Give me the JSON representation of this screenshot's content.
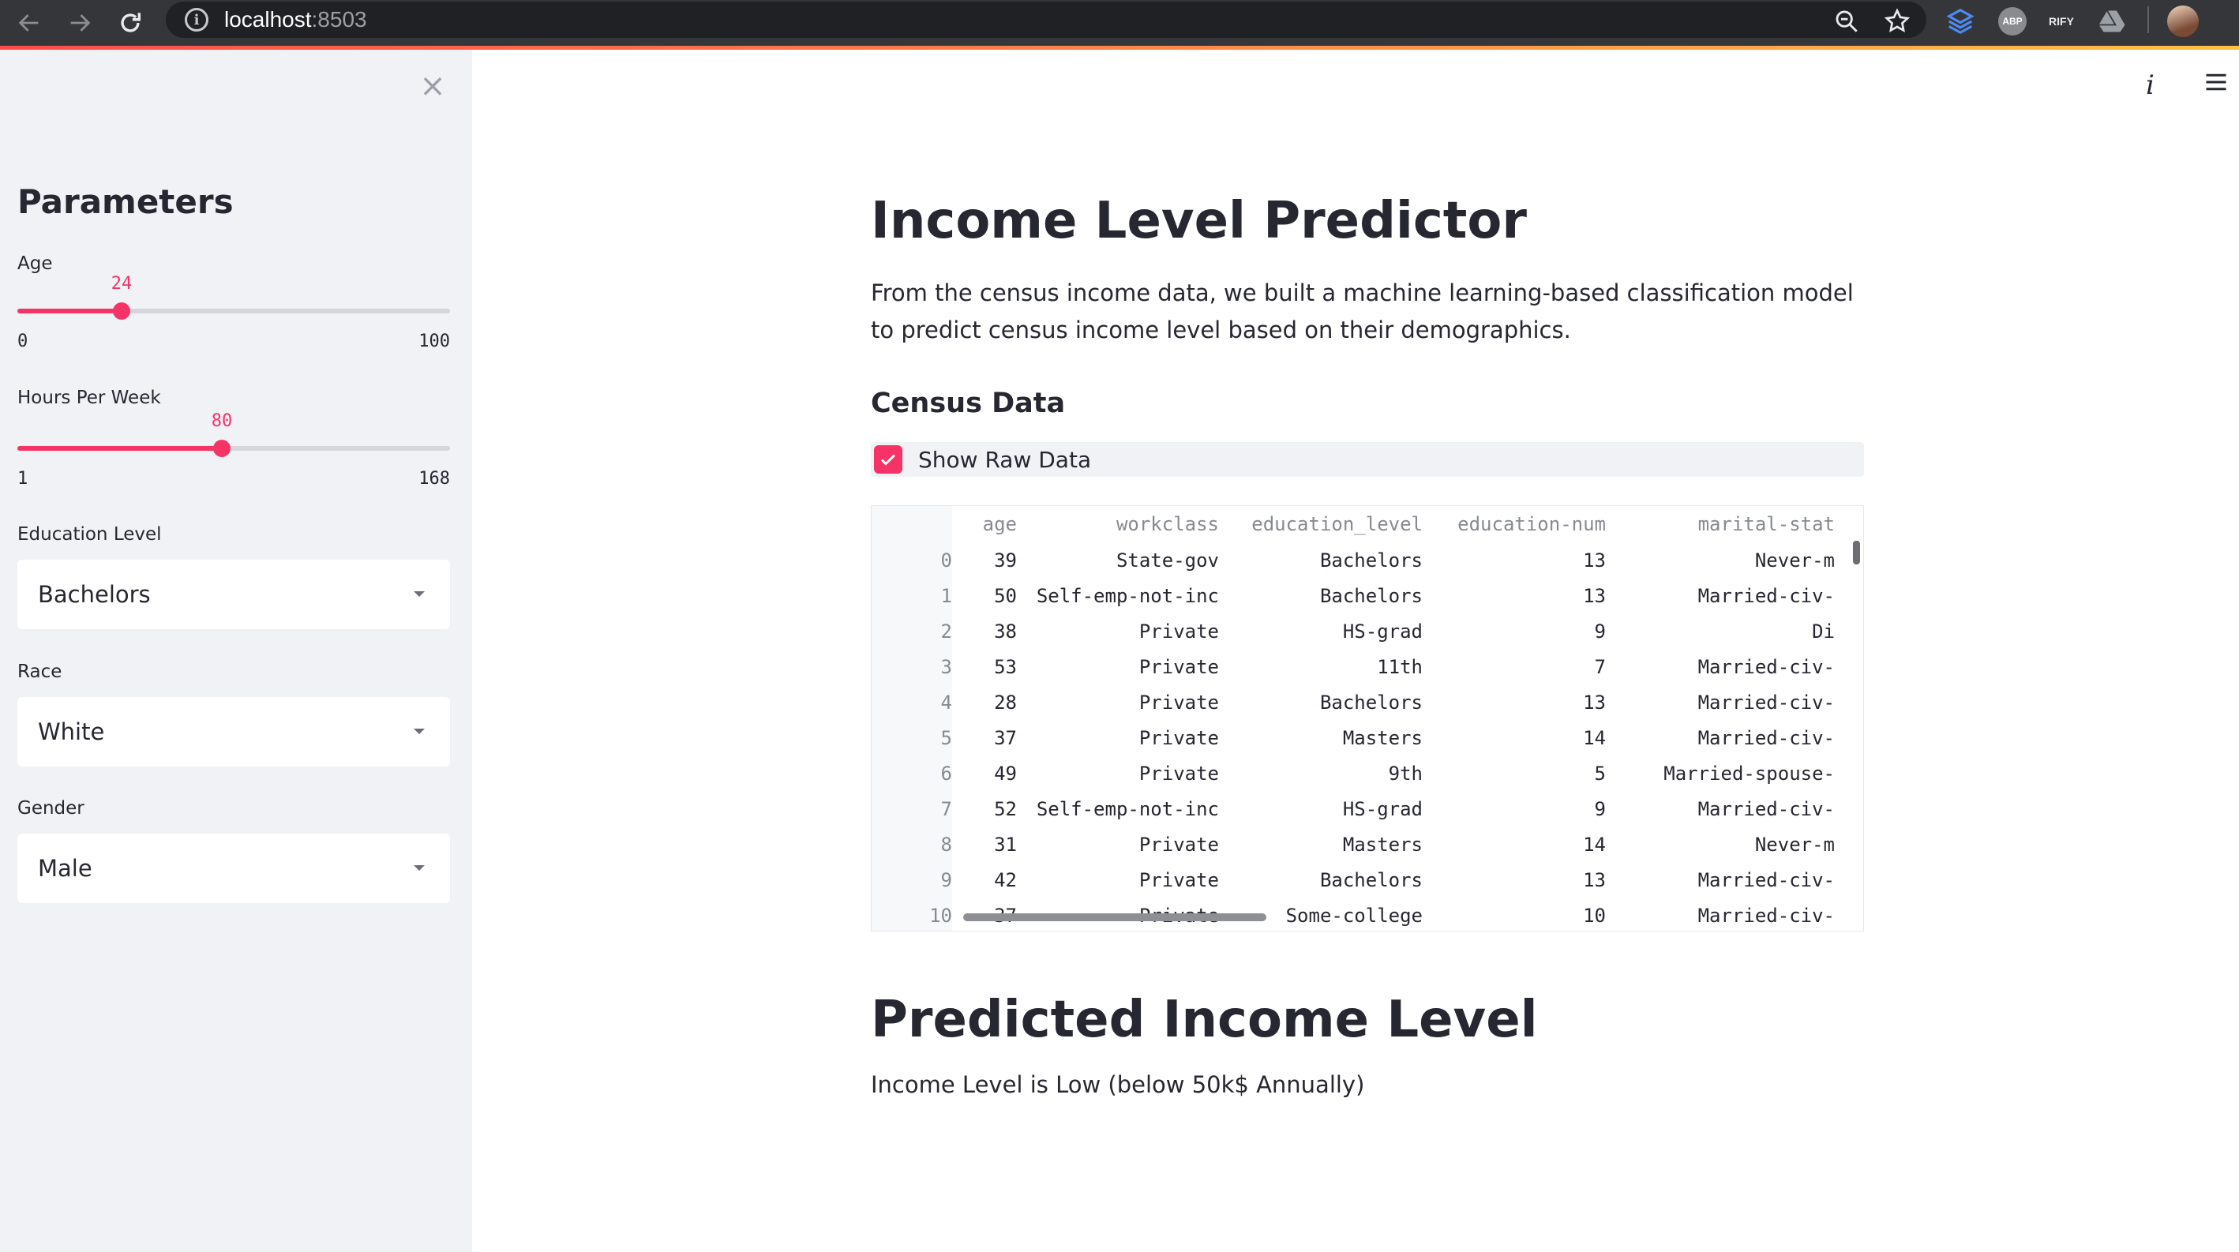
{
  "browser": {
    "url_host": "localhost",
    "url_port": ":8503",
    "extensions": [
      "ABP",
      "RIFY"
    ]
  },
  "sidebar": {
    "title": "Parameters",
    "age": {
      "label": "Age",
      "value": 24,
      "min": 0,
      "max": 100,
      "min_label": "0",
      "max_label": "100"
    },
    "hours": {
      "label": "Hours Per Week",
      "value": 80,
      "min": 1,
      "max": 168,
      "min_label": "1",
      "max_label": "168"
    },
    "education": {
      "label": "Education Level",
      "selected": "Bachelors"
    },
    "race": {
      "label": "Race",
      "selected": "White"
    },
    "gender": {
      "label": "Gender",
      "selected": "Male"
    }
  },
  "main": {
    "title": "Income Level Predictor",
    "description": "From the census income data, we built a machine learning-based classification model to predict census income level based on their demographics.",
    "section_title": "Census Data",
    "checkbox_label": "Show Raw Data",
    "prediction_title": "Predicted Income Level",
    "prediction_text": "Income Level is Low (below 50k$ Annually)"
  },
  "table": {
    "columns": [
      "",
      "age",
      "workclass",
      "education_level",
      "education-num",
      "marital-stat"
    ],
    "rows": [
      [
        "0",
        "39",
        "State-gov",
        "Bachelors",
        "13",
        "Never-m"
      ],
      [
        "1",
        "50",
        "Self-emp-not-inc",
        "Bachelors",
        "13",
        "Married-civ-"
      ],
      [
        "2",
        "38",
        "Private",
        "HS-grad",
        "9",
        "Di"
      ],
      [
        "3",
        "53",
        "Private",
        "11th",
        "7",
        "Married-civ-"
      ],
      [
        "4",
        "28",
        "Private",
        "Bachelors",
        "13",
        "Married-civ-"
      ],
      [
        "5",
        "37",
        "Private",
        "Masters",
        "14",
        "Married-civ-"
      ],
      [
        "6",
        "49",
        "Private",
        "9th",
        "5",
        "Married-spouse-"
      ],
      [
        "7",
        "52",
        "Self-emp-not-inc",
        "HS-grad",
        "9",
        "Married-civ-"
      ],
      [
        "8",
        "31",
        "Private",
        "Masters",
        "14",
        "Never-m"
      ],
      [
        "9",
        "42",
        "Private",
        "Bachelors",
        "13",
        "Married-civ-"
      ],
      [
        "10",
        "37",
        "Private",
        "Some-college",
        "10",
        "Married-civ-"
      ]
    ]
  },
  "colors": {
    "accent": "#f63366",
    "sidebar_bg": "#f0f2f6",
    "text": "#262730"
  }
}
